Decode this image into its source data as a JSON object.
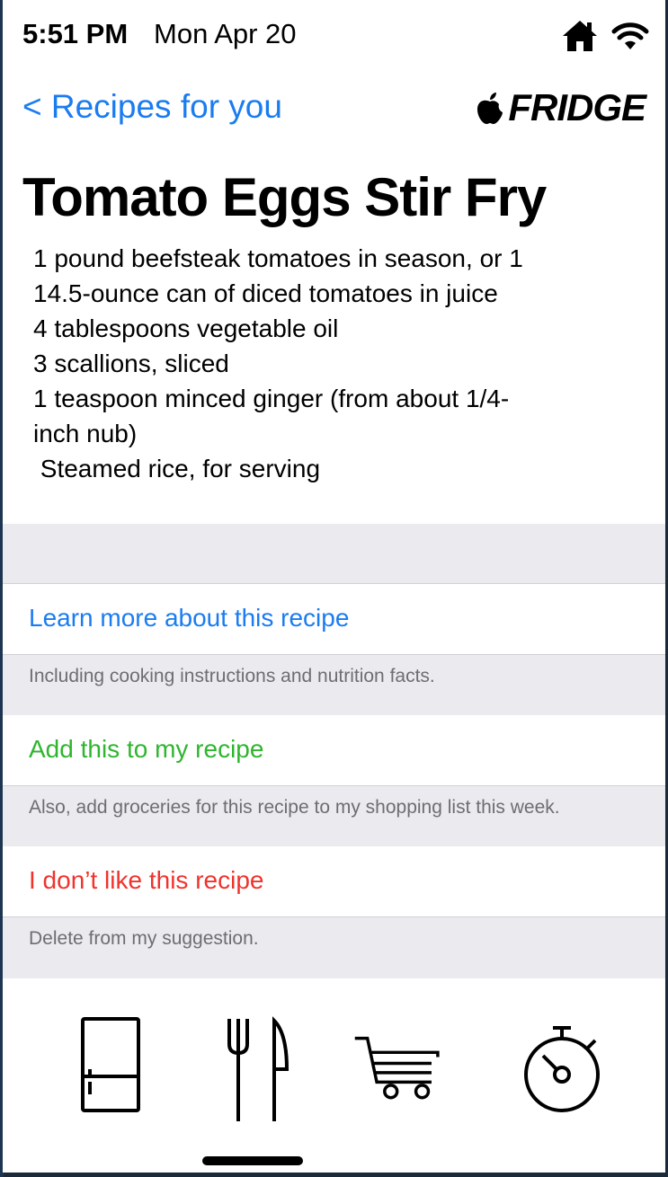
{
  "status_bar": {
    "time": "5:51 PM",
    "date": "Mon Apr 20",
    "icons": [
      "home-icon",
      "wifi-icon"
    ]
  },
  "nav": {
    "back_label": "< Recipes for you",
    "brand_logo": "apple-logo-icon",
    "brand_name": "FRIDGE"
  },
  "recipe": {
    "title": "Tomato Eggs Stir Fry",
    "ingredients": [
      "1 pound beefsteak tomatoes in season, or 1",
      "14.5-ounce can of diced tomatoes in juice",
      "4 tablespoons vegetable oil",
      "3 scallions, sliced",
      "1 teaspoon minced ginger (from about 1/4-",
      "inch nub)",
      " Steamed rice, for serving"
    ]
  },
  "actions": {
    "learn_more": {
      "label": "Learn more about this recipe",
      "footer": "Including cooking instructions and nutrition facts.",
      "color": "#1a7cf0"
    },
    "add_recipe": {
      "label": "Add this to my recipe",
      "footer": "Also, add groceries for this recipe to my shopping list this week.",
      "color": "#2fb52f"
    },
    "dislike": {
      "label": "I don’t like this recipe",
      "footer": "Delete from my suggestion.",
      "color": "#f0332d"
    }
  },
  "tabbar": {
    "tabs": [
      "fridge-icon",
      "utensils-icon",
      "shopping-cart-icon",
      "timer-icon"
    ]
  }
}
